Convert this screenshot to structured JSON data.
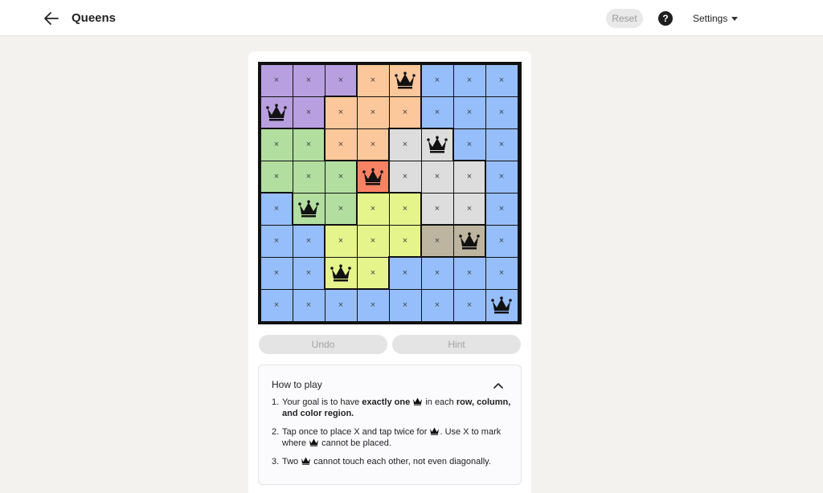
{
  "header": {
    "title": "Queens",
    "reset_label": "Reset",
    "help_label": "?",
    "settings_label": "Settings"
  },
  "board": {
    "size": 8,
    "regions": [
      [
        "purple",
        "purple",
        "purple",
        "orange",
        "orange",
        "blue",
        "blue",
        "blue"
      ],
      [
        "purple",
        "purple",
        "orange",
        "orange",
        "orange",
        "blue",
        "blue",
        "blue"
      ],
      [
        "green",
        "green",
        "orange",
        "orange",
        "gray",
        "gray",
        "blue",
        "blue"
      ],
      [
        "green",
        "green",
        "green",
        "red",
        "gray",
        "gray",
        "gray",
        "blue"
      ],
      [
        "blue",
        "green",
        "green",
        "yellow",
        "yellow",
        "gray",
        "gray",
        "blue"
      ],
      [
        "blue",
        "blue",
        "yellow",
        "yellow",
        "yellow",
        "tan",
        "tan",
        "blue"
      ],
      [
        "blue",
        "blue",
        "yellow",
        "yellow",
        "blue",
        "blue",
        "blue",
        "blue"
      ],
      [
        "blue",
        "blue",
        "blue",
        "blue",
        "blue",
        "blue",
        "blue",
        "blue"
      ]
    ],
    "cells": [
      [
        "×",
        "×",
        "×",
        "×",
        "Q",
        "×",
        "×",
        "×"
      ],
      [
        "Q",
        "×",
        "×",
        "×",
        "×",
        "×",
        "×",
        "×"
      ],
      [
        "×",
        "×",
        "×",
        "×",
        "×",
        "Q",
        "×",
        "×"
      ],
      [
        "×",
        "×",
        "×",
        "Q",
        "×",
        "×",
        "×",
        "×"
      ],
      [
        "×",
        "Q",
        "×",
        "×",
        "×",
        "×",
        "×",
        "×"
      ],
      [
        "×",
        "×",
        "×",
        "×",
        "×",
        "×",
        "Q",
        "×"
      ],
      [
        "×",
        "×",
        "Q",
        "×",
        "×",
        "×",
        "×",
        "×"
      ],
      [
        "×",
        "×",
        "×",
        "×",
        "×",
        "×",
        "×",
        "Q"
      ]
    ],
    "region_colors": {
      "purple": "#b8a0e0",
      "orange": "#fcc79a",
      "blue": "#96befa",
      "green": "#b2dea0",
      "gray": "#dddddd",
      "red": "#fa8264",
      "yellow": "#e6f48c",
      "tan": "#bdb59f"
    }
  },
  "controls": {
    "undo_label": "Undo",
    "hint_label": "Hint"
  },
  "how_to_play": {
    "title": "How to play",
    "rules": [
      {
        "num": "1.",
        "before": "Your goal is to have ",
        "bold1": "exactly one",
        "mid": " in each ",
        "bold2": "row, column,",
        "bold3": "and color region."
      },
      {
        "num": "2.",
        "line1_before": "Tap once to place X and tap twice for",
        "line1_after": ". Use X to mark",
        "line2_before": "where",
        "line2_after": " cannot be placed."
      },
      {
        "num": "3.",
        "before": "Two",
        "after": " cannot touch each other, not even diagonally."
      }
    ]
  }
}
